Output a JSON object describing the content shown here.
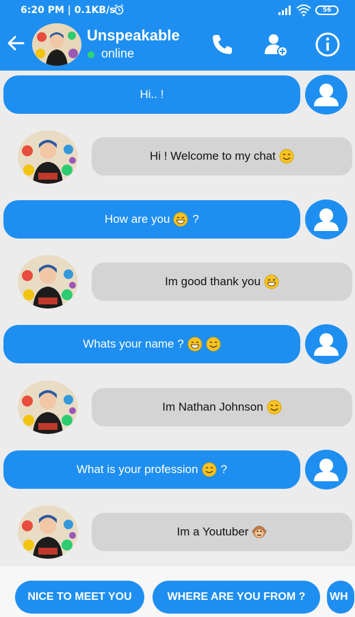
{
  "status": {
    "time": "6:20 PM",
    "speed": "0.1KB/s",
    "battery": "56"
  },
  "header": {
    "name": "Unspeakable",
    "presence": "online"
  },
  "messages": [
    {
      "from": "user",
      "text": "Hi.. !"
    },
    {
      "from": "bot",
      "text": "Hi ! Welcome to my chat",
      "emoji": [
        "smile"
      ]
    },
    {
      "from": "user",
      "text": "How are you",
      "emoji": [
        "grin"
      ],
      "suffix": "?"
    },
    {
      "from": "bot",
      "text": "Im good thank you",
      "emoji": [
        "sweat-smile"
      ]
    },
    {
      "from": "user",
      "text": "Whats your name ?",
      "emoji": [
        "grin",
        "smile"
      ]
    },
    {
      "from": "bot",
      "text": "Im Nathan Johnson",
      "emoji": [
        "smile"
      ]
    },
    {
      "from": "user",
      "text": "What is your profession",
      "emoji": [
        "smile"
      ],
      "suffix": "?"
    },
    {
      "from": "bot",
      "text": "Im a Youtuber",
      "emoji": [
        "monkey"
      ]
    }
  ],
  "quick_replies": [
    "NICE TO MEET YOU",
    "WHERE ARE YOU FROM ?",
    "WH"
  ],
  "colors": {
    "primary": "#1e8ff0",
    "bubble_in": "#d4d4d4",
    "background": "#ececec",
    "online": "#2ed573"
  }
}
